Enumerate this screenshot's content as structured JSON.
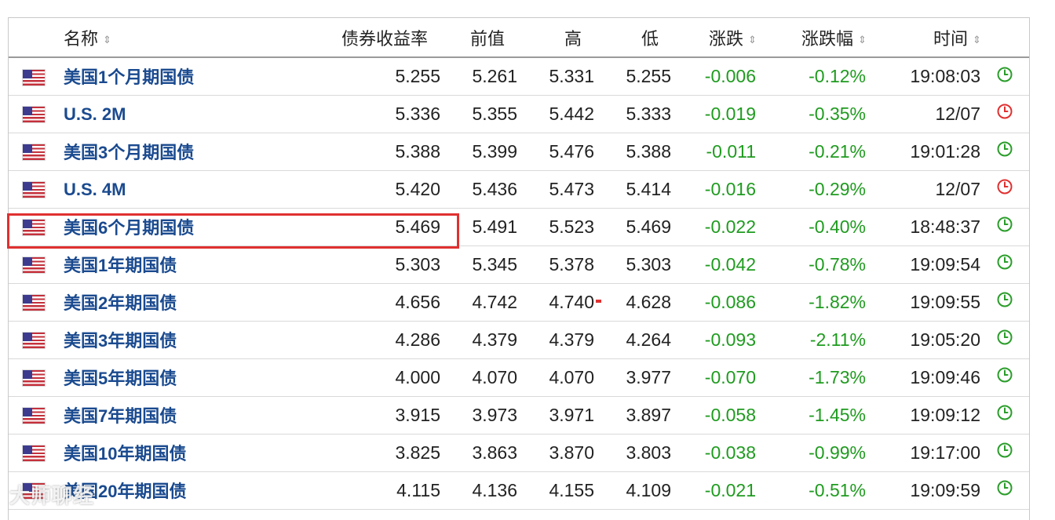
{
  "columns": {
    "name": "名称",
    "yield": "债券收益率",
    "prev": "前值",
    "high": "高",
    "low": "低",
    "change": "涨跌",
    "change_pct": "涨跌幅",
    "time": "时间"
  },
  "sort_icon": "sort-updown-icon",
  "colors": {
    "link": "#1a4a8f",
    "negative": "#1f9b1f",
    "highlight": "#e03030",
    "clock_live": "#2a9d2a",
    "clock_closed": "#e03030"
  },
  "rows": [
    {
      "name": "美国1个月期国债",
      "yield": "5.255",
      "prev": "5.261",
      "high": "5.331",
      "low": "5.255",
      "change": "-0.006",
      "change_pct": "-0.12%",
      "time": "19:08:03",
      "status": "live"
    },
    {
      "name": "U.S. 2M",
      "yield": "5.336",
      "prev": "5.355",
      "high": "5.442",
      "low": "5.333",
      "change": "-0.019",
      "change_pct": "-0.35%",
      "time": "12/07",
      "status": "closed"
    },
    {
      "name": "美国3个月期国债",
      "yield": "5.388",
      "prev": "5.399",
      "high": "5.476",
      "low": "5.388",
      "change": "-0.011",
      "change_pct": "-0.21%",
      "time": "19:01:28",
      "status": "live"
    },
    {
      "name": "U.S. 4M",
      "yield": "5.420",
      "prev": "5.436",
      "high": "5.473",
      "low": "5.414",
      "change": "-0.016",
      "change_pct": "-0.29%",
      "time": "12/07",
      "status": "closed"
    },
    {
      "name": "美国6个月期国债",
      "yield": "5.469",
      "prev": "5.491",
      "high": "5.523",
      "low": "5.469",
      "change": "-0.022",
      "change_pct": "-0.40%",
      "time": "18:48:37",
      "status": "live"
    },
    {
      "name": "美国1年期国债",
      "yield": "5.303",
      "prev": "5.345",
      "high": "5.378",
      "low": "5.303",
      "change": "-0.042",
      "change_pct": "-0.78%",
      "time": "19:09:54",
      "status": "live"
    },
    {
      "name": "美国2年期国债",
      "yield": "4.656",
      "prev": "4.742",
      "high": "4.740",
      "low": "4.628",
      "change": "-0.086",
      "change_pct": "-1.82%",
      "time": "19:09:55",
      "status": "live"
    },
    {
      "name": "美国3年期国债",
      "yield": "4.286",
      "prev": "4.379",
      "high": "4.379",
      "low": "4.264",
      "change": "-0.093",
      "change_pct": "-2.11%",
      "time": "19:05:20",
      "status": "live"
    },
    {
      "name": "美国5年期国债",
      "yield": "4.000",
      "prev": "4.070",
      "high": "4.070",
      "low": "3.977",
      "change": "-0.070",
      "change_pct": "-1.73%",
      "time": "19:09:46",
      "status": "live"
    },
    {
      "name": "美国7年期国债",
      "yield": "3.915",
      "prev": "3.973",
      "high": "3.971",
      "low": "3.897",
      "change": "-0.058",
      "change_pct": "-1.45%",
      "time": "19:09:12",
      "status": "live"
    },
    {
      "name": "美国10年期国债",
      "yield": "3.825",
      "prev": "3.863",
      "high": "3.870",
      "low": "3.803",
      "change": "-0.038",
      "change_pct": "-0.99%",
      "time": "19:17:00",
      "status": "live"
    },
    {
      "name": "美国20年期国债",
      "yield": "4.115",
      "prev": "4.136",
      "high": "4.155",
      "low": "4.109",
      "change": "-0.021",
      "change_pct": "-0.51%",
      "time": "19:09:59",
      "status": "live"
    }
  ],
  "highlighted_row": "美国6个月期国债",
  "watermark": "大师聊经"
}
